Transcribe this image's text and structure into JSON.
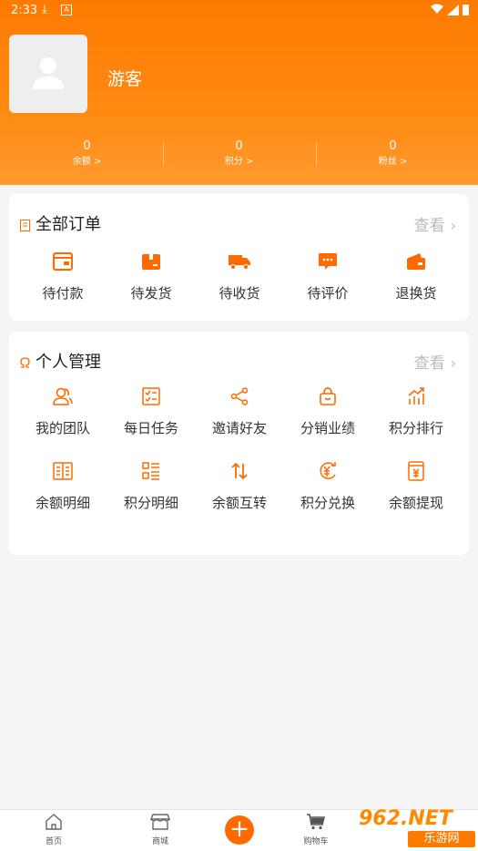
{
  "status_bar": {
    "time": "2:33"
  },
  "profile": {
    "name": "游客"
  },
  "stats": [
    {
      "value": "0",
      "label": "余额 >"
    },
    {
      "value": "0",
      "label": "积分 >"
    },
    {
      "value": "0",
      "label": "粉丝 >"
    }
  ],
  "orders": {
    "title": "全部订单",
    "more": "查看",
    "items": [
      {
        "label": "待付款",
        "icon": "wallet-icon"
      },
      {
        "label": "待发货",
        "icon": "box-icon"
      },
      {
        "label": "待收货",
        "icon": "truck-icon"
      },
      {
        "label": "待评价",
        "icon": "comment-icon"
      },
      {
        "label": "退换货",
        "icon": "return-icon"
      }
    ]
  },
  "management": {
    "title": "个人管理",
    "more": "查看",
    "items": [
      {
        "label": "我的团队",
        "icon": "team-icon"
      },
      {
        "label": "每日任务",
        "icon": "checklist-icon"
      },
      {
        "label": "邀请好友",
        "icon": "share-icon"
      },
      {
        "label": "分销业绩",
        "icon": "bag-icon"
      },
      {
        "label": "积分排行",
        "icon": "rank-chart-icon"
      },
      {
        "label": "余额明细",
        "icon": "ledger-icon"
      },
      {
        "label": "积分明细",
        "icon": "list-icon"
      },
      {
        "label": "余额互转",
        "icon": "transfer-icon"
      },
      {
        "label": "积分兑换",
        "icon": "exchange-icon"
      },
      {
        "label": "余额提现",
        "icon": "withdraw-icon"
      }
    ]
  },
  "tabbar": {
    "items": [
      {
        "label": "首页",
        "icon": "home-icon"
      },
      {
        "label": "商城",
        "icon": "store-icon"
      },
      {
        "label": "",
        "icon": "plus-icon"
      },
      {
        "label": "购物车",
        "icon": "cart-icon"
      }
    ]
  },
  "watermark": {
    "top": "962.NET",
    "bottom": "乐游网"
  },
  "colors": {
    "accent": "#ff7a00",
    "icon": "#ff6a00",
    "muted": "#bbbbbb"
  }
}
